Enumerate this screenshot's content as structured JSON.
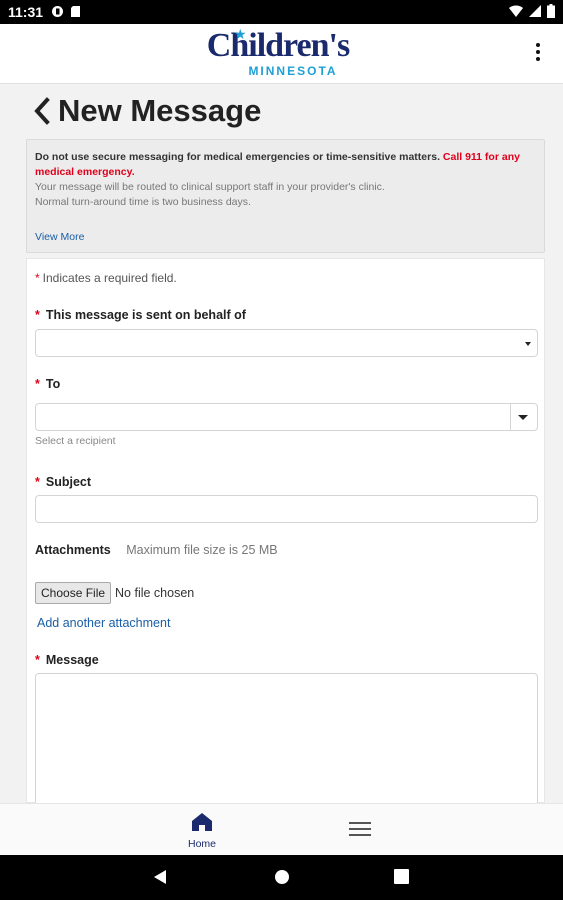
{
  "status_bar": {
    "time": "11:31"
  },
  "header": {
    "logo_main": "Children's",
    "logo_sub": "MINNESOTA"
  },
  "page": {
    "title": "New Message"
  },
  "notice": {
    "line1": "Do not use secure messaging for medical emergencies or time-sensitive matters.",
    "emergency": "Call 911 for any medical emergency.",
    "line2": "Your message will be routed to clinical support staff in your provider's clinic.",
    "line3": "Normal turn-around time is two business days.",
    "view_more": "View More"
  },
  "form": {
    "required_star": "*",
    "required_note": "Indicates a required field.",
    "behalf_label": "This message is sent on behalf of",
    "to_label": "To",
    "to_hint": "Select a recipient",
    "subject_label": "Subject",
    "attachments_label": "Attachments",
    "attachments_max": "Maximum file size is 25 MB",
    "choose_file": "Choose File",
    "no_file": "No file chosen",
    "add_attachment": "Add another attachment",
    "message_label": "Message"
  },
  "bottom_nav": {
    "home_label": "Home"
  },
  "colors": {
    "brand_navy": "#1a2a6c",
    "brand_blue": "#1ea0d6",
    "required_red": "#e0001b",
    "link_blue": "#1b5ea7"
  }
}
